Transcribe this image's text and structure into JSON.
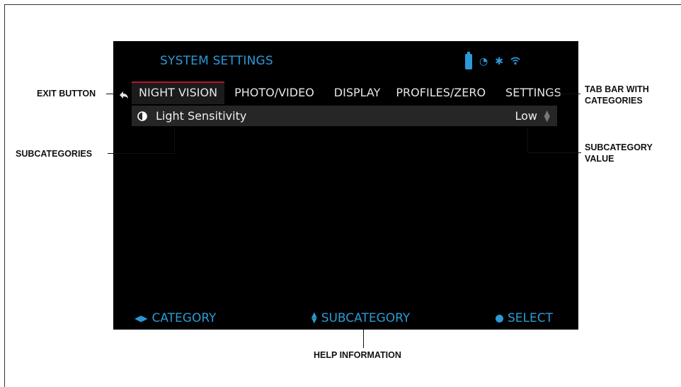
{
  "screen": {
    "title": "SYSTEM SETTINGS",
    "status_icons": [
      "battery-icon",
      "timer-icon",
      "bluetooth-icon",
      "wifi-icon"
    ],
    "tabs": [
      {
        "label": "NIGHT VISION",
        "active": true
      },
      {
        "label": "PHOTO/VIDEO",
        "active": false
      },
      {
        "label": "DISPLAY",
        "active": false
      },
      {
        "label": "PROFILES/ZERO",
        "active": false
      },
      {
        "label": "SETTINGS",
        "active": false
      }
    ],
    "rows": [
      {
        "icon": "brightness-icon",
        "label": "Light Sensitivity",
        "value": "Low"
      }
    ],
    "help": {
      "category": "CATEGORY",
      "subcategory": "SUBCATEGORY",
      "select": "SELECT"
    }
  },
  "callouts": {
    "exit_button": "EXIT BUTTON",
    "tab_bar_line1": "TAB BAR WITH",
    "tab_bar_line2": "CATEGORIES",
    "subcategories": "SUBCATEGORIES",
    "subcategory_value_line1": "SUBCATEGORY",
    "subcategory_value_line2": "VALUE",
    "help_information": "HELP INFORMATION"
  },
  "colors": {
    "accent": "#2b9ad6",
    "active_tab_underline": "#b0182a",
    "screen_background": "#000000",
    "row_background": "#262626"
  }
}
